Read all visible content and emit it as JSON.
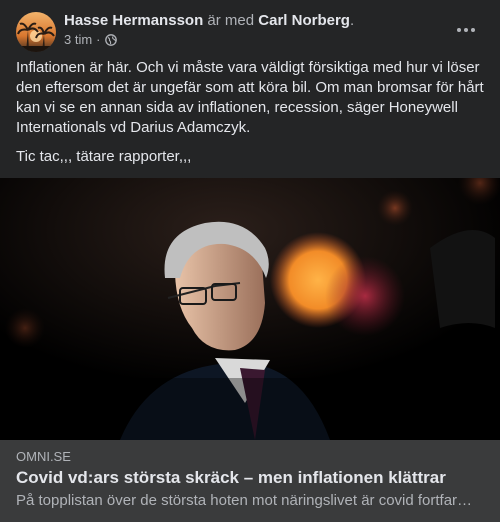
{
  "post": {
    "author": "Hasse Hermansson",
    "with_text": "är med",
    "tagged": "Carl Norberg",
    "trailing": ".",
    "time": "3 tim",
    "separator": "·",
    "privacy_icon": "globe-icon",
    "menu_icon": "more-horizontal-icon",
    "paragraphs": [
      "Inflationen är här. Och vi måste vara väldigt försiktiga med hur vi löser den eftersom det är ungefär som att köra bil. Om man bromsar för hårt kan vi se en annan sida av inflationen, recession, säger Honeywell Internationals vd Darius Adamczyk.",
      "Tic tac,,, tätare rapporter,,,"
    ]
  },
  "link": {
    "domain": "OMNI.SE",
    "title": "Covid vd:ars största skräck – men inflationen klättrar",
    "description": "På topplistan över de största hoten mot näringslivet är covid fortfar…"
  },
  "colors": {
    "background": "#242526",
    "link_card": "#3a3b3c",
    "text_primary": "#e4e6eb",
    "text_secondary": "#b0b3b8"
  }
}
